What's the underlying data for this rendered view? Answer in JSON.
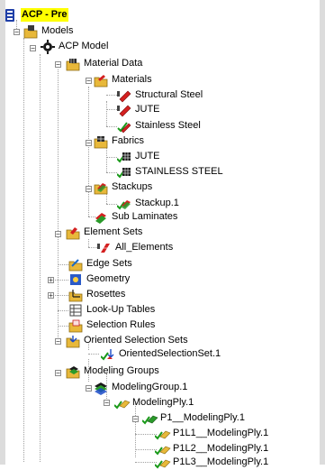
{
  "tree": {
    "root": "ACP - Pre",
    "models": "Models",
    "acp_model": "ACP Model",
    "material_data": "Material Data",
    "materials": "Materials",
    "materials_items": [
      "Structural Steel",
      "JUTE",
      "Stainless Steel"
    ],
    "fabrics": "Fabrics",
    "fabrics_items": [
      "JUTE",
      "STAINLESS STEEL"
    ],
    "stackups": "Stackups",
    "stackups_items": [
      "Stackup.1"
    ],
    "sub_laminates": "Sub Laminates",
    "element_sets": "Element Sets",
    "element_sets_items": [
      "All_Elements"
    ],
    "edge_sets": "Edge Sets",
    "geometry": "Geometry",
    "rosettes": "Rosettes",
    "lookup_tables": "Look-Up Tables",
    "selection_rules": "Selection Rules",
    "oriented_selection_sets": "Oriented Selection Sets",
    "oriented_selection_sets_items": [
      "OrientedSelectionSet.1"
    ],
    "modeling_groups": "Modeling Groups",
    "modeling_group": "ModelingGroup.1",
    "modeling_ply": "ModelingPly.1",
    "p1_modeling_ply": "P1__ModelingPly.1",
    "production_plies": [
      "P1L1__ModelingPly.1",
      "P1L2__ModelingPly.1",
      "P1L3__ModelingPly.1"
    ]
  },
  "colors": {
    "root_highlight": "#ffff00",
    "check_green": "#1a9a1a",
    "material_red": "#d42020",
    "folder_yellow": "#e8b83a"
  }
}
